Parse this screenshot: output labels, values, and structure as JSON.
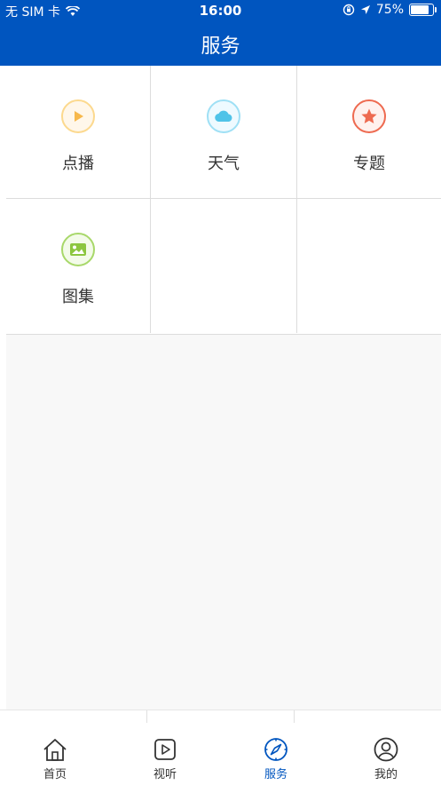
{
  "status_bar": {
    "carrier": "无 SIM 卡",
    "time": "16:00",
    "battery": "75%"
  },
  "nav": {
    "title": "服务"
  },
  "services": [
    {
      "label": "点播",
      "icon": "play-icon",
      "color": "#f7b84b"
    },
    {
      "label": "天气",
      "icon": "cloud-icon",
      "color": "#4fc3e8"
    },
    {
      "label": "专题",
      "icon": "star-icon",
      "color": "#ee6a50"
    },
    {
      "label": "图集",
      "icon": "image-icon",
      "color": "#8cc63f"
    }
  ],
  "tabs": [
    {
      "label": "首页",
      "icon": "home-icon",
      "active": false
    },
    {
      "label": "视听",
      "icon": "play-box-icon",
      "active": false
    },
    {
      "label": "服务",
      "icon": "compass-icon",
      "active": true
    },
    {
      "label": "我的",
      "icon": "user-icon",
      "active": false
    }
  ],
  "colors": {
    "primary": "#0055bf",
    "background": "#f8f8f8"
  }
}
